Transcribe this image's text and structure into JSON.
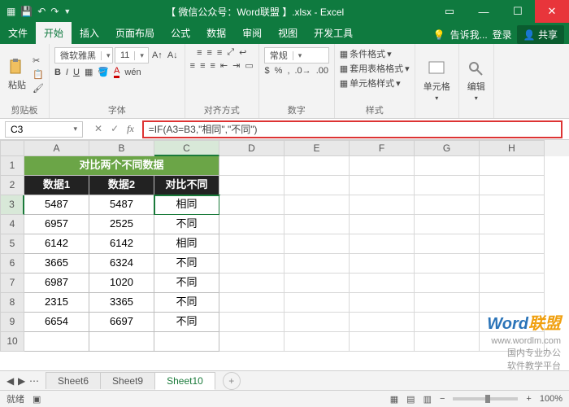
{
  "title": "【 微信公众号：Word联盟 】.xlsx - Excel",
  "tabs": {
    "file": "文件",
    "home": "开始",
    "insert": "插入",
    "layout": "页面布局",
    "formula": "公式",
    "data": "数据",
    "review": "审阅",
    "view": "视图",
    "dev": "开发工具",
    "tell": "告诉我...",
    "login": "登录",
    "share": "共享"
  },
  "ribbon": {
    "clipboard": {
      "paste": "粘贴",
      "label": "剪贴板"
    },
    "font": {
      "family": "微软雅黑",
      "size": "11",
      "label": "字体"
    },
    "align": {
      "label": "对齐方式"
    },
    "number": {
      "general": "常规",
      "label": "数字"
    },
    "styles": {
      "cond": "条件格式",
      "tablefmt": "套用表格格式",
      "cellstyle": "单元格样式",
      "label": "样式"
    },
    "cells": {
      "label": "单元格"
    },
    "editing": {
      "label": "编辑"
    }
  },
  "namebox": "C3",
  "formula": "=IF(A3=B3,\"相同\",\"不同\")",
  "cols": [
    "A",
    "B",
    "C",
    "D",
    "E",
    "F",
    "G",
    "H"
  ],
  "mergedTitle": "对比两个不同数据",
  "headers": {
    "a": "数据1",
    "b": "数据2",
    "c": "对比不同"
  },
  "data": [
    {
      "r": 3,
      "a": "5487",
      "b": "5487",
      "c": "相同"
    },
    {
      "r": 4,
      "a": "6957",
      "b": "2525",
      "c": "不同"
    },
    {
      "r": 5,
      "a": "6142",
      "b": "6142",
      "c": "相同"
    },
    {
      "r": 6,
      "a": "3665",
      "b": "6324",
      "c": "不同"
    },
    {
      "r": 7,
      "a": "6987",
      "b": "1020",
      "c": "不同"
    },
    {
      "r": 8,
      "a": "2315",
      "b": "3365",
      "c": "不同"
    },
    {
      "r": 9,
      "a": "6654",
      "b": "6697",
      "c": "不同"
    }
  ],
  "sheets": {
    "s6": "Sheet6",
    "s9": "Sheet9",
    "s10": "Sheet10"
  },
  "status": {
    "ready": "就绪",
    "zoom": "100%"
  },
  "watermark": {
    "brand1": "Word",
    "brand2": "联盟",
    "url": "www.wordlm.com",
    "line1": "国内专业办公",
    "line2": "软件教学平台"
  }
}
